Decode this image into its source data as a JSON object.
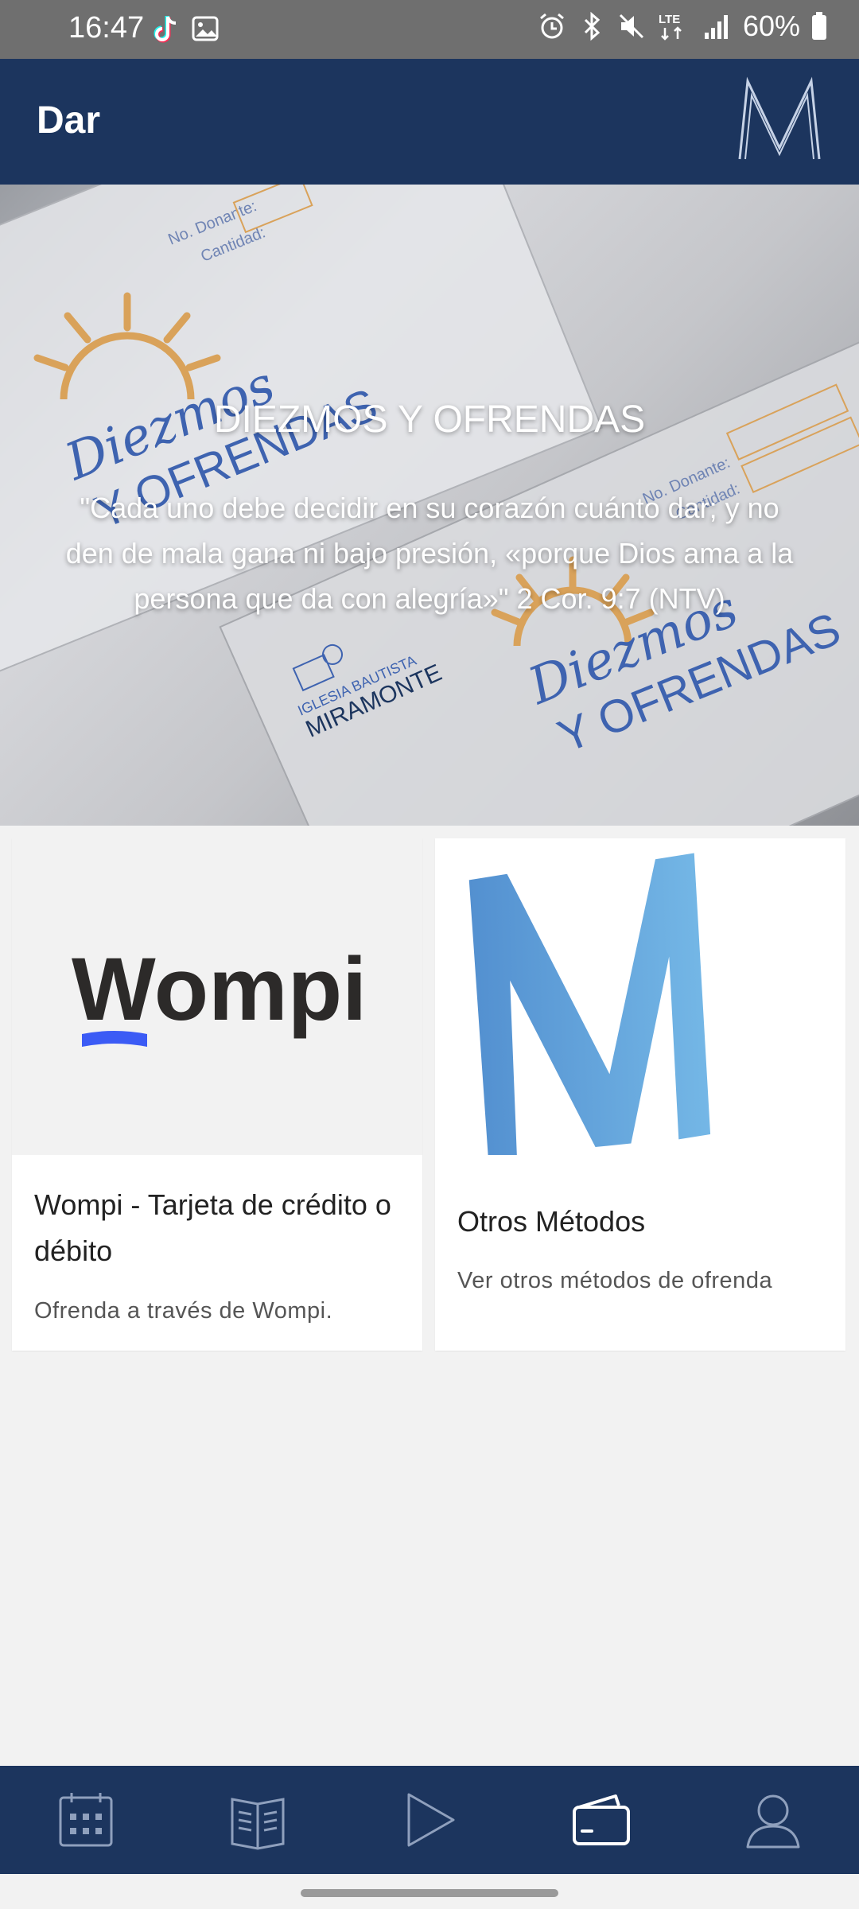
{
  "status_bar": {
    "time": "16:47",
    "battery": "60%",
    "network": "LTE",
    "icons": [
      "tiktok-icon",
      "gallery-icon",
      "alarm-icon",
      "bluetooth-icon",
      "mute-icon",
      "lte-icon",
      "signal-icon",
      "battery-icon"
    ]
  },
  "app_bar": {
    "title": "Dar",
    "logo_letter": "M"
  },
  "hero": {
    "title": "DIEZMOS Y OFRENDAS",
    "quote": "\"Cada uno debe decidir en su corazón cuánto dar; y no den de mala gana ni bajo presión, «porque Dios ama a la persona que da con alegría»\" 2 Cor. 9:7 (NTV)",
    "envelope": {
      "brand_line1": "Diezmos",
      "brand_line2": "Y OFRENDAS",
      "field_donor": "No. Donante:",
      "field_amount": "Cantidad:",
      "church_small": "IGLESIA BAUTISTA",
      "church_name": "MIRAMONTE"
    }
  },
  "cards": [
    {
      "logo_text": "Wompi",
      "title": "Wompi - Tarjeta de crédito o débito",
      "subtitle": "Ofrenda a través de Wompi."
    },
    {
      "logo_letter": "M",
      "title": "Otros Métodos",
      "subtitle": "Ver otros métodos de ofrenda"
    }
  ],
  "bottom_nav": {
    "items": [
      "calendar-icon",
      "book-icon",
      "play-icon",
      "wallet-icon",
      "profile-icon"
    ],
    "active": "wallet-icon"
  },
  "colors": {
    "primary": "#1c355e",
    "wompi_accent": "#3b5bf5",
    "m_logo": "#5b9bd8",
    "envelope_sun": "#d9a25a",
    "envelope_text": "#3e63b0"
  }
}
